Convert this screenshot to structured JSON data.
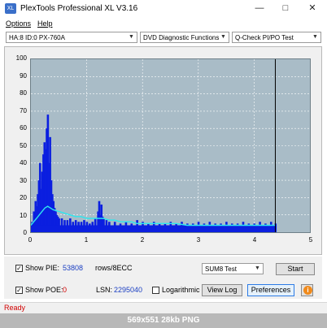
{
  "window": {
    "title": "PlexTools Professional XL V3.16",
    "icon_label": "XL",
    "minimize_icon": "minimize-icon",
    "maximize_icon": "maximize-icon",
    "close_icon": "close-icon"
  },
  "menu": {
    "items": [
      "Options",
      "Help"
    ]
  },
  "toolbar": {
    "drive": "HA:8 ID:0  PX-760A",
    "function": "DVD Diagnostic Functions",
    "test": "Q-Check PI/PO Test"
  },
  "chart_data": {
    "type": "area",
    "ylim": [
      0,
      100
    ],
    "xlim": [
      0,
      5
    ],
    "yticks": [
      "100",
      "90",
      "80",
      "70",
      "60",
      "50",
      "40",
      "30",
      "20",
      "10",
      "0"
    ],
    "xticks": [
      "0",
      "1",
      "2",
      "3",
      "4",
      "5"
    ],
    "grid": true,
    "end_marker_x": 4.38,
    "colors": {
      "background": "#a9bcc7",
      "pie_bars": "#0b1fe0",
      "sum_line": "#2ee6ee",
      "grid": "#ffffff"
    },
    "series": [
      {
        "kind": "bars",
        "x": [
          0.02,
          0.05,
          0.08,
          0.1,
          0.12,
          0.14,
          0.16,
          0.18,
          0.2,
          0.22,
          0.24,
          0.26,
          0.28,
          0.3,
          0.32,
          0.34,
          0.36,
          0.38,
          0.4,
          0.42,
          0.44,
          0.46,
          0.48,
          0.5,
          0.55,
          0.6,
          0.65,
          0.7,
          0.75,
          0.8,
          0.85,
          0.9,
          0.95,
          1.0,
          1.05,
          1.1,
          1.15,
          1.2,
          1.22,
          1.24,
          1.26,
          1.28,
          1.3,
          1.35,
          1.4,
          1.5,
          1.6,
          1.7,
          1.8,
          1.9,
          2.0,
          2.1,
          2.2,
          2.3,
          2.4,
          2.5,
          2.6,
          2.7,
          2.8,
          2.9,
          3.0,
          3.1,
          3.2,
          3.3,
          3.4,
          3.5,
          3.6,
          3.7,
          3.8,
          3.9,
          4.0,
          4.1,
          4.2,
          4.3,
          4.38
        ],
        "values": [
          6,
          12,
          18,
          15,
          22,
          30,
          40,
          25,
          35,
          45,
          52,
          48,
          60,
          68,
          40,
          55,
          30,
          22,
          18,
          14,
          12,
          10,
          9,
          8,
          8,
          7,
          7,
          8,
          6,
          7,
          6,
          6,
          7,
          6,
          5,
          6,
          8,
          12,
          18,
          10,
          16,
          9,
          8,
          7,
          6,
          6,
          5,
          6,
          5,
          7,
          6,
          5,
          6,
          5,
          5,
          6,
          5,
          6,
          5,
          5,
          6,
          5,
          6,
          5,
          5,
          6,
          5,
          5,
          6,
          5,
          5,
          6,
          5,
          6,
          5
        ]
      },
      {
        "kind": "line",
        "x": [
          0,
          0.05,
          0.1,
          0.15,
          0.2,
          0.25,
          0.3,
          0.35,
          0.4,
          0.5,
          0.6,
          0.7,
          0.8,
          0.9,
          1.0,
          1.1,
          1.2,
          1.3,
          1.4,
          1.5,
          1.6,
          1.7,
          1.8,
          1.9,
          2.0,
          2.2,
          2.4,
          2.6,
          2.8,
          3.0,
          3.2,
          3.4,
          3.6,
          3.8,
          4.0,
          4.2,
          4.38
        ],
        "values": [
          4,
          6,
          8,
          10,
          12,
          14,
          15,
          14,
          13,
          12,
          11,
          10,
          9,
          9,
          8,
          8,
          8,
          8,
          7,
          7,
          6,
          6,
          6,
          5,
          5,
          5,
          5,
          5,
          4,
          4,
          4,
          4,
          4,
          4,
          4,
          4,
          4
        ]
      }
    ]
  },
  "controls": {
    "show_pie_label": "Show PIE:",
    "pie_value": "53808",
    "pie_unit": "rows/8ECC",
    "show_poe_label": "Show POE:",
    "poe_value": "0",
    "lsn_label": "LSN:",
    "lsn_value": "2295040",
    "logarithmic_label": "Logarithmic",
    "sum_mode": "SUM8 Test",
    "start_label": "Start",
    "view_log_label": "View Log",
    "preferences_label": "Preferences",
    "help_icon": "info-icon"
  },
  "status": {
    "text": "Ready",
    "color": "#d10000"
  },
  "caption": {
    "text": "569x551  28kb  PNG"
  }
}
